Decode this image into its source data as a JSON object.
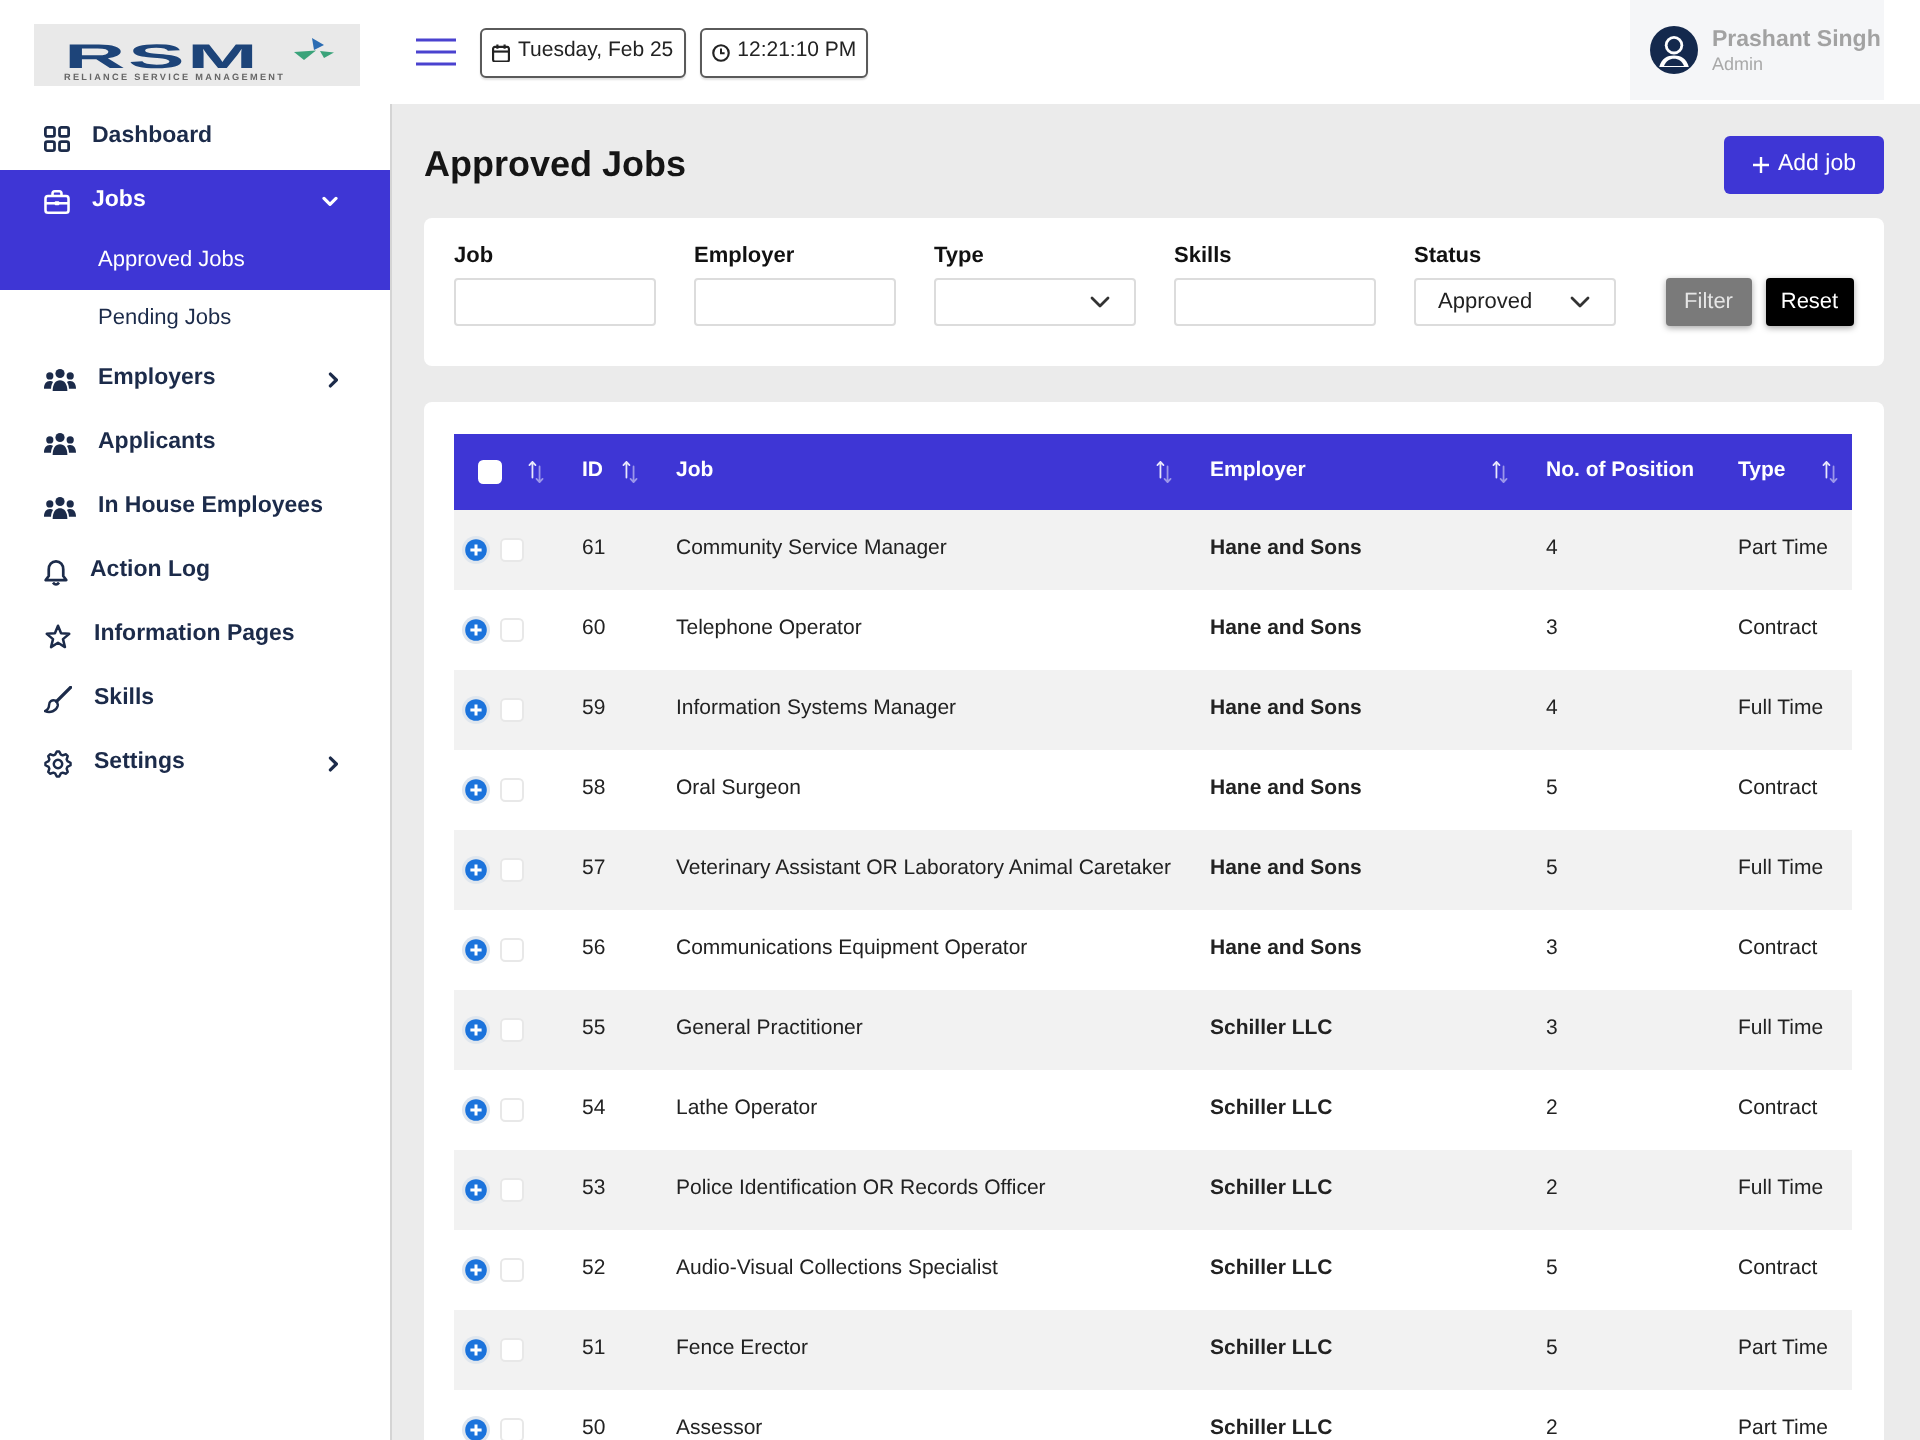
{
  "sidebar": {
    "logo": {
      "wordmark": "RSM",
      "tagline": "RELIANCE SERVICE MANAGEMENT"
    },
    "items": [
      {
        "label": "Dashboard",
        "selected": false
      },
      {
        "label": "Jobs",
        "selected": true,
        "expanded": true,
        "children": [
          {
            "label": "Approved Jobs",
            "selected": true
          },
          {
            "label": "Pending Jobs",
            "selected": false
          }
        ]
      },
      {
        "label": "Employers",
        "selected": false,
        "expanded": false
      },
      {
        "label": "Applicants",
        "selected": false
      },
      {
        "label": "In House Employees",
        "selected": false
      },
      {
        "label": "Action Log",
        "selected": false
      },
      {
        "label": "Information Pages",
        "selected": false
      },
      {
        "label": "Skills",
        "selected": false
      },
      {
        "label": "Settings",
        "selected": false,
        "expanded": false
      }
    ]
  },
  "header": {
    "date": "Tuesday, Feb 25",
    "time": "12:21:10 PM",
    "user": {
      "name": "Prashant Singh",
      "role": "Admin"
    }
  },
  "page": {
    "title": "Approved Jobs",
    "add_button": "Add job"
  },
  "filters": {
    "fields": [
      {
        "label": "Job",
        "kind": "text"
      },
      {
        "label": "Employer",
        "kind": "text"
      },
      {
        "label": "Type",
        "kind": "select"
      },
      {
        "label": "Skills",
        "kind": "text"
      },
      {
        "label": "Status",
        "kind": "select",
        "value": "Approved"
      }
    ],
    "buttons": [
      {
        "label": "Filter",
        "kind": "secondary"
      },
      {
        "label": "Reset",
        "kind": "dark"
      }
    ]
  },
  "table": {
    "columns": [
      {
        "kind": "select",
        "checked": false,
        "sortable": true
      },
      {
        "kind": "text",
        "label": "ID",
        "sortable": true
      },
      {
        "kind": "text",
        "label": "Job",
        "sortable": true
      },
      {
        "kind": "text",
        "label": "Employer",
        "sortable": true
      },
      {
        "kind": "text",
        "label": "No. of Position",
        "sortable": false
      },
      {
        "kind": "text",
        "label": "Type",
        "sortable": true
      }
    ],
    "rows": [
      {
        "expanded": false,
        "checked": false,
        "id": "61",
        "job": "Community Service Manager",
        "employer": "Hane and Sons",
        "positions": "4",
        "type": "Part Time"
      },
      {
        "expanded": false,
        "checked": false,
        "id": "60",
        "job": "Telephone Operator",
        "employer": "Hane and Sons",
        "positions": "3",
        "type": "Contract"
      },
      {
        "expanded": false,
        "checked": false,
        "id": "59",
        "job": "Information Systems Manager",
        "employer": "Hane and Sons",
        "positions": "4",
        "type": "Full Time"
      },
      {
        "expanded": false,
        "checked": false,
        "id": "58",
        "job": "Oral Surgeon",
        "employer": "Hane and Sons",
        "positions": "5",
        "type": "Contract"
      },
      {
        "expanded": false,
        "checked": false,
        "id": "57",
        "job": "Veterinary Assistant OR Laboratory Animal Caretaker",
        "employer": "Hane and Sons",
        "positions": "5",
        "type": "Full Time"
      },
      {
        "expanded": false,
        "checked": false,
        "id": "56",
        "job": "Communications Equipment Operator",
        "employer": "Hane and Sons",
        "positions": "3",
        "type": "Contract"
      },
      {
        "expanded": false,
        "checked": false,
        "id": "55",
        "job": "General Practitioner",
        "employer": "Schiller LLC",
        "positions": "3",
        "type": "Full Time"
      },
      {
        "expanded": false,
        "checked": false,
        "id": "54",
        "job": "Lathe Operator",
        "employer": "Schiller LLC",
        "positions": "2",
        "type": "Contract"
      },
      {
        "expanded": false,
        "checked": false,
        "id": "53",
        "job": "Police Identification OR Records Officer",
        "employer": "Schiller LLC",
        "positions": "2",
        "type": "Full Time"
      },
      {
        "expanded": false,
        "checked": false,
        "id": "52",
        "job": "Audio-Visual Collections Specialist",
        "employer": "Schiller LLC",
        "positions": "5",
        "type": "Contract"
      },
      {
        "expanded": false,
        "checked": false,
        "id": "51",
        "job": "Fence Erector",
        "employer": "Schiller LLC",
        "positions": "5",
        "type": "Part Time"
      },
      {
        "expanded": false,
        "checked": false,
        "id": "50",
        "job": "Assessor",
        "employer": "Schiller LLC",
        "positions": "2",
        "type": "Part Time"
      }
    ]
  }
}
